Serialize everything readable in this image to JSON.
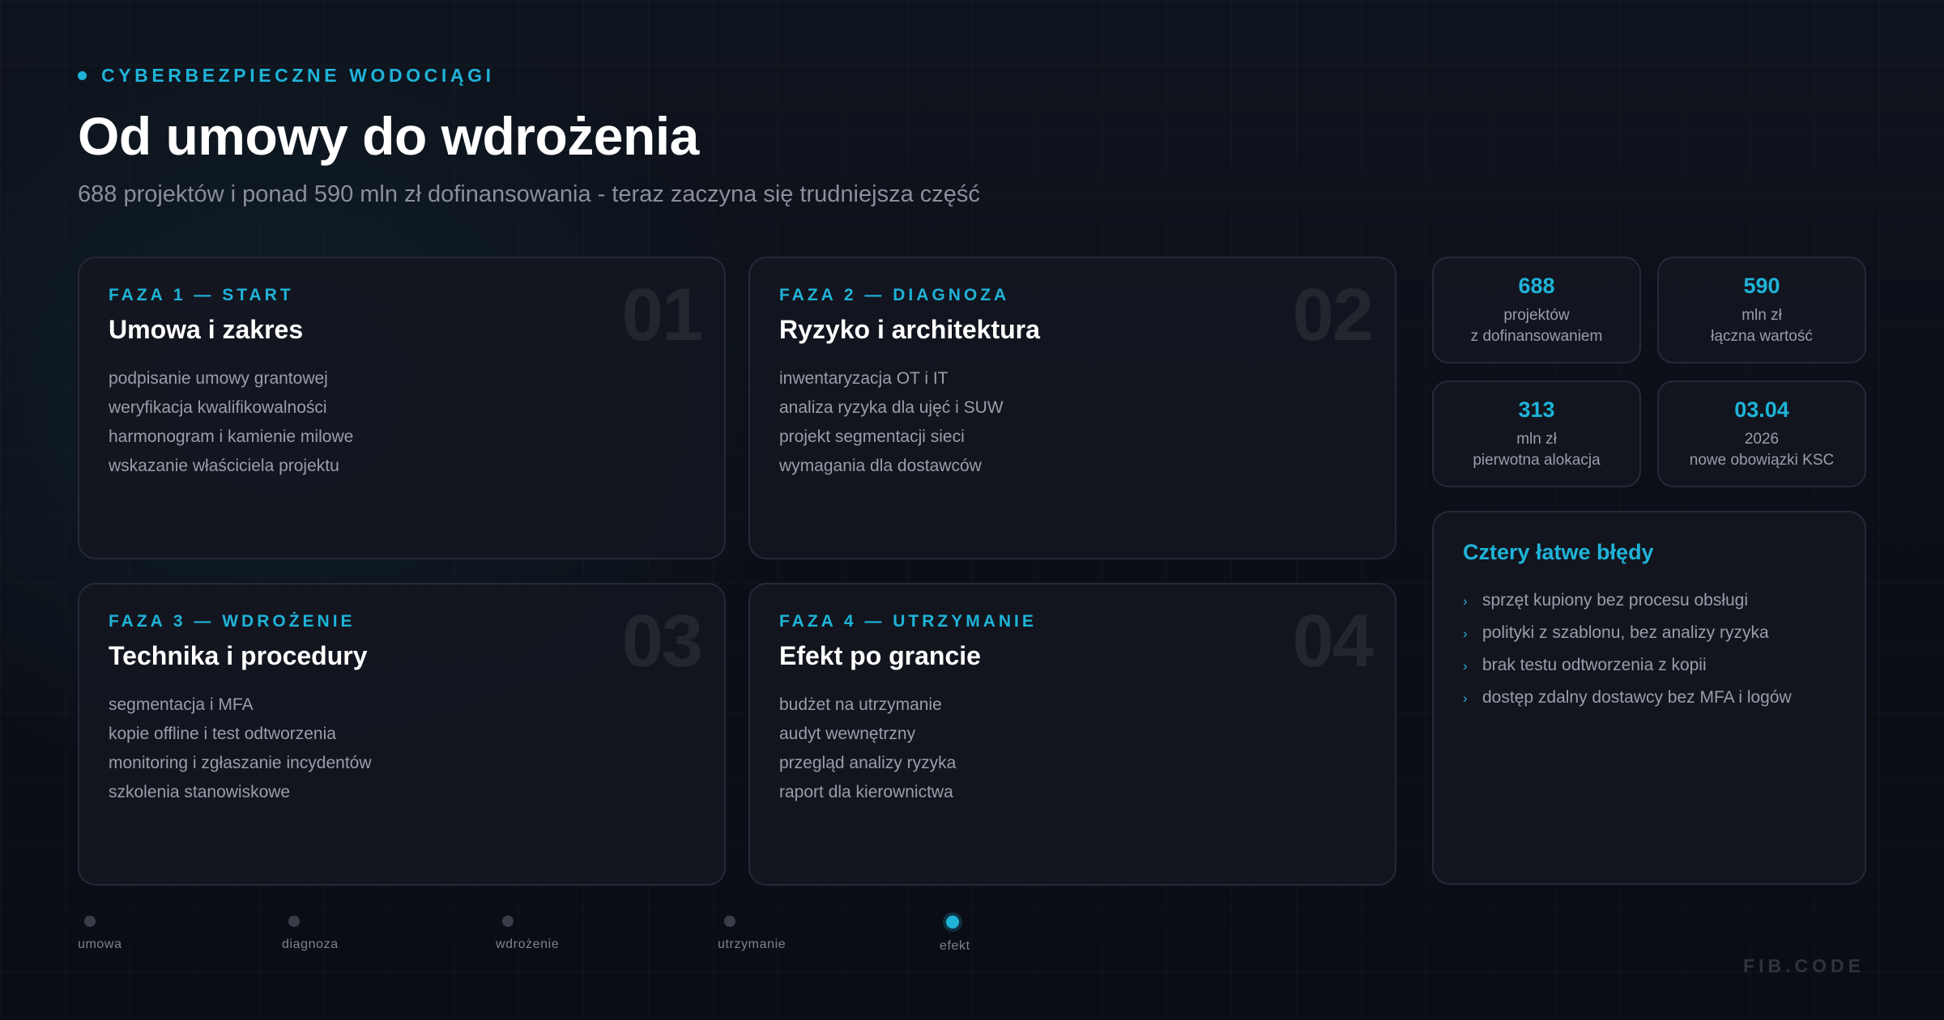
{
  "header": {
    "kicker": "CYBERBEZPIECZNE WODOCIĄGI",
    "title": "Od umowy do wdrożenia",
    "subtitle": "688 projektów i ponad 590 mln zł dofinansowania - teraz zaczyna się trudniejsza część"
  },
  "phases": [
    {
      "label": "FAZA 1 — START",
      "title": "Umowa i zakres",
      "number": "01",
      "items": [
        "podpisanie umowy grantowej",
        "weryfikacja kwalifikowalności",
        "harmonogram i kamienie milowe",
        "wskazanie właściciela projektu"
      ]
    },
    {
      "label": "FAZA 2 — DIAGNOZA",
      "title": "Ryzyko i architektura",
      "number": "02",
      "items": [
        "inwentaryzacja OT i IT",
        "analiza ryzyka dla ujęć i SUW",
        "projekt segmentacji sieci",
        "wymagania dla dostawców"
      ]
    },
    {
      "label": "FAZA 3 — WDROŻENIE",
      "title": "Technika i procedury",
      "number": "03",
      "items": [
        "segmentacja i MFA",
        "kopie offline i test odtworzenia",
        "monitoring i zgłaszanie incydentów",
        "szkolenia stanowiskowe"
      ]
    },
    {
      "label": "FAZA 4 — UTRZYMANIE",
      "title": "Efekt po grancie",
      "number": "04",
      "items": [
        "budżet na utrzymanie",
        "audyt wewnętrzny",
        "przegląd analizy ryzyka",
        "raport dla kierownictwa"
      ]
    }
  ],
  "stats": [
    {
      "value": "688",
      "line1": "projektów",
      "line2": "z dofinansowaniem"
    },
    {
      "value": "590",
      "line1": "mln zł",
      "line2": "łączna wartość"
    },
    {
      "value": "313",
      "line1": "mln zł",
      "line2": "pierwotna alokacja"
    },
    {
      "value": "03.04",
      "line1": "2026",
      "line2": "nowe obowiązki KSC"
    }
  ],
  "mistakes": {
    "title": "Cztery łatwe błędy",
    "bullet": "›",
    "items": [
      "sprzęt kupiony bez procesu obsługi",
      "polityki z szablonu, bez analizy ryzyka",
      "brak testu odtworzenia z kopii",
      "dostęp zdalny dostawcy bez MFA i logów"
    ]
  },
  "timeline": {
    "active_index": 4,
    "steps": [
      "umowa",
      "diagnoza",
      "wdrożenie",
      "utrzymanie",
      "efekt"
    ]
  },
  "brand": "FIB.CODE",
  "colors": {
    "accent": "#1fb3d8",
    "background": "#0c0e16",
    "card": "#14161f"
  }
}
